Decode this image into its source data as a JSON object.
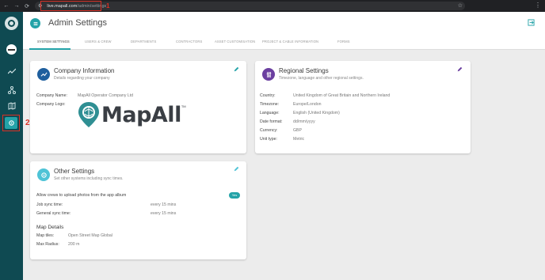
{
  "browser": {
    "back": "←",
    "forward": "→",
    "reload": "⟳",
    "url_host": "live.mapall.com",
    "url_path": "/admin/settings",
    "star": "☆",
    "menu": "⋮"
  },
  "annotations": {
    "callout_1": "1",
    "callout_2": "2",
    "highlight_color": "#d93025"
  },
  "sidebar": {
    "background": "#0f4a52",
    "active_color": "#24a3a8",
    "icons": [
      "logo-icon",
      "avatar-icon",
      "activity-icon",
      "network-icon",
      "map-icon",
      "settings-icon"
    ]
  },
  "header": {
    "title": "Admin Settings",
    "icon": "menu-icon",
    "exit_icon": "exit-icon"
  },
  "tabs": [
    {
      "label": "SYSTEM SETTINGS",
      "active": true
    },
    {
      "label": "USERS & CREW",
      "active": false
    },
    {
      "label": "DEPARTMENTS",
      "active": false
    },
    {
      "label": "CONTRACTORS",
      "active": false
    },
    {
      "label": "ASSET CUSTOMISATION",
      "active": false
    },
    {
      "label": "PROJECT & CABLE INFORMATION",
      "active": false
    },
    {
      "label": "FORMS",
      "active": false
    }
  ],
  "company": {
    "title": "Company Information",
    "subtitle": "Details regarding your company",
    "name_label": "Company Name:",
    "name_value": "MapAll Operator Company Ltd",
    "logo_label": "Company Logo:",
    "logo_text": "MapAll",
    "logo_tm": "TM",
    "icon_color": "#1f5f9e"
  },
  "regional": {
    "title": "Regional Settings",
    "subtitle": "Timezone, language and other regional settings.",
    "icon_color": "#6b3fa0",
    "rows": [
      {
        "label": "Country:",
        "value": "United Kingdom of Great Britain and Northern Ireland"
      },
      {
        "label": "Timezone:",
        "value": "Europe/London"
      },
      {
        "label": "Language:",
        "value": "English (United Kingdom)"
      },
      {
        "label": "Date format:",
        "value": "dd/mm/yyyy"
      },
      {
        "label": "Currency:",
        "value": "GBP"
      },
      {
        "label": "Unit type:",
        "value": "Metric"
      }
    ]
  },
  "other": {
    "title": "Other Settings",
    "subtitle": "Set other systems including sync times.",
    "icon_color": "#4ec3d6",
    "upload_label": "Allow crews to upload photos from the app album",
    "upload_value": "Yes",
    "job_sync_label": "Job sync time:",
    "job_sync_value": "every 15 mins",
    "general_sync_label": "General sync time:",
    "general_sync_value": "every 15 mins",
    "map_title": "Map Details",
    "map_tiles_label": "Map tiles:",
    "map_tiles_value": "Open Street Map Global",
    "max_radius_label": "Max Radius:",
    "max_radius_value": "200 m"
  }
}
